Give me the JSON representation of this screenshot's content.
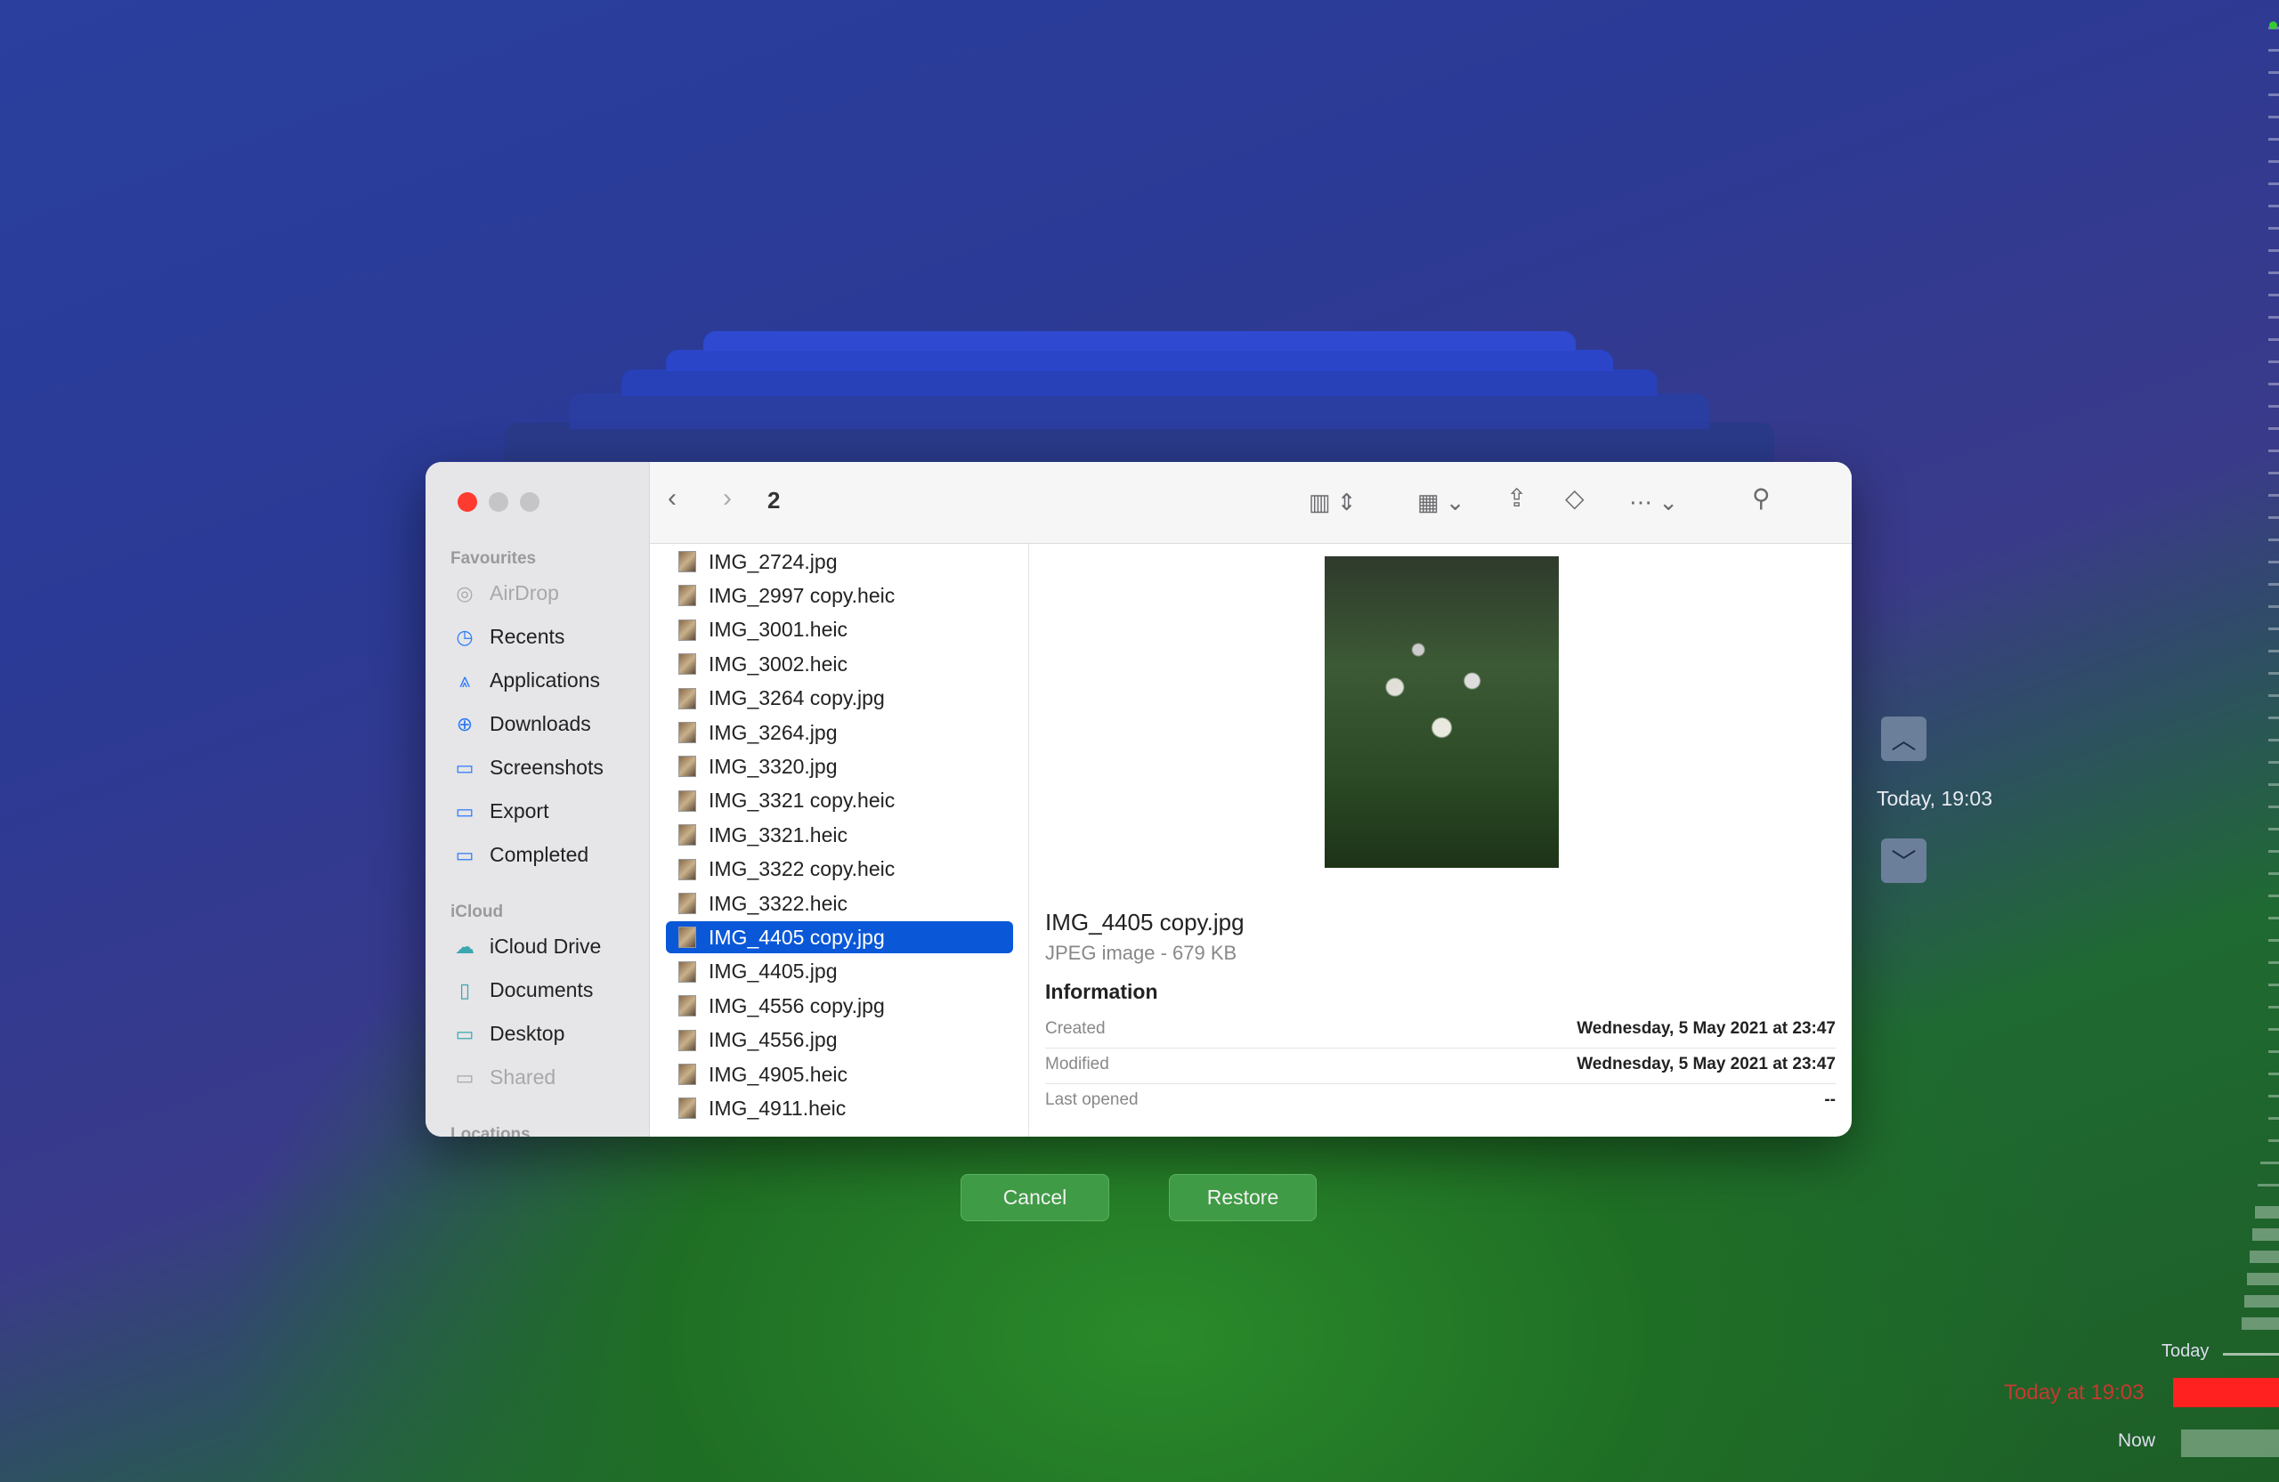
{
  "finder": {
    "path_title": "2",
    "sidebar": {
      "favourites_label": "Favourites",
      "icloud_label": "iCloud",
      "locations_label": "Locations",
      "favourites": [
        {
          "label": "AirDrop",
          "icon": "airdrop-icon"
        },
        {
          "label": "Recents",
          "icon": "clock-icon"
        },
        {
          "label": "Applications",
          "icon": "applications-icon"
        },
        {
          "label": "Downloads",
          "icon": "download-icon"
        },
        {
          "label": "Screenshots",
          "icon": "folder-icon"
        },
        {
          "label": "Export",
          "icon": "folder-icon"
        },
        {
          "label": "Completed",
          "icon": "folder-icon"
        }
      ],
      "icloud": [
        {
          "label": "iCloud Drive",
          "icon": "cloud-icon"
        },
        {
          "label": "Documents",
          "icon": "document-icon"
        },
        {
          "label": "Desktop",
          "icon": "desktop-icon"
        },
        {
          "label": "Shared",
          "icon": "shared-folder-icon"
        }
      ]
    },
    "files": [
      "IMG_2724.jpg",
      "IMG_2997 copy.heic",
      "IMG_3001.heic",
      "IMG_3002.heic",
      "IMG_3264 copy.jpg",
      "IMG_3264.jpg",
      "IMG_3320.jpg",
      "IMG_3321 copy.heic",
      "IMG_3321.heic",
      "IMG_3322 copy.heic",
      "IMG_3322.heic",
      "IMG_4405 copy.jpg",
      "IMG_4405.jpg",
      "IMG_4556 copy.jpg",
      "IMG_4556.jpg",
      "IMG_4905.heic",
      "IMG_4911.heic"
    ],
    "selected_file": "IMG_4405 copy.jpg",
    "preview": {
      "name": "IMG_4405 copy.jpg",
      "kind": "JPEG image - 679 KB",
      "info_heading": "Information",
      "rows": [
        {
          "k": "Created",
          "v": "Wednesday, 5 May 2021 at 23:47"
        },
        {
          "k": "Modified",
          "v": "Wednesday, 5 May 2021 at 23:47"
        },
        {
          "k": "Last opened",
          "v": "--"
        }
      ]
    }
  },
  "buttons": {
    "cancel": "Cancel",
    "restore": "Restore"
  },
  "timemachine": {
    "current_snapshot": "Today, 19:03",
    "timeline": {
      "today": "Today",
      "selected": "Today at 19:03",
      "now": "Now"
    }
  },
  "colors": {
    "selection": "#0a58d8",
    "accent_red": "#ff2020",
    "button_green": "#3f9b45"
  }
}
